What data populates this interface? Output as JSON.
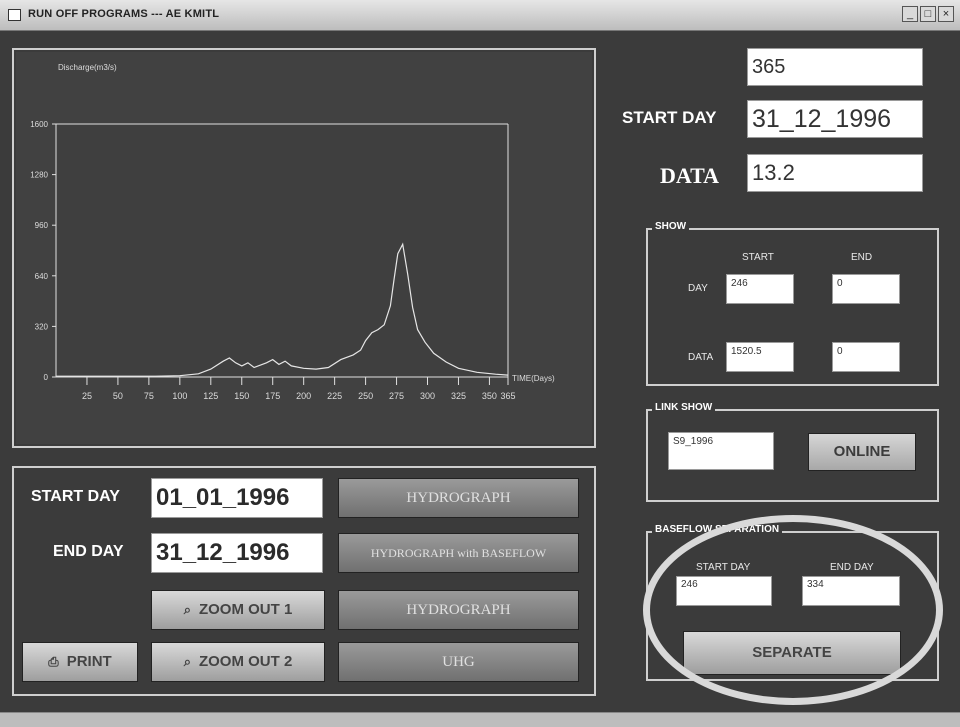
{
  "window": {
    "title": "RUN OFF PROGRAMS --- AE KMITL",
    "min_label": "_",
    "max_label": "□",
    "close_label": "×"
  },
  "top": {
    "days_value": "365",
    "start_day_label": "START DAY",
    "start_day_value": "31_12_1996",
    "data_label": "DATA",
    "data_value": "13.2"
  },
  "show": {
    "caption": "SHOW",
    "start_header": "START",
    "end_header": "END",
    "day_label": "DAY",
    "data_label": "DATA",
    "day_start": "246",
    "day_end": "0",
    "data_start": "1520.5",
    "data_end": "0"
  },
  "link_show": {
    "caption": "LINK SHOW",
    "value": "S9_1996",
    "online_label": "ONLINE"
  },
  "baseflow": {
    "caption": "BASEFLOW SEPARATION",
    "start_day_label": "START DAY",
    "end_day_label": "END DAY",
    "start_day_value": "246",
    "end_day_value": "334",
    "separate_label": "SEPARATE"
  },
  "controls": {
    "start_day_label": "START DAY",
    "start_day_value": "01_01_1996",
    "end_day_label": "END DAY",
    "end_day_value": "31_12_1996",
    "zoom_out_1": "ZOOM OUT 1",
    "zoom_out_2": "ZOOM OUT 2",
    "print_label": "PRINT",
    "hydrograph_btn": "HYDROGRAPH",
    "hydrograph_baseflow_btn": "HYDROGRAPH with BASEFLOW",
    "hydrograph_btn_2": "HYDROGRAPH",
    "uhg_btn": "UHG"
  },
  "chart_data": {
    "type": "line",
    "ylabel": "Discharge(m3/s)",
    "xlabel": "TIME(Days)",
    "xlim": [
      0,
      365
    ],
    "ylim": [
      0,
      1600
    ],
    "xticks": [
      25,
      50,
      75,
      100,
      125,
      150,
      175,
      200,
      225,
      250,
      275,
      300,
      325,
      350,
      365
    ],
    "yticks": [
      0,
      320,
      640,
      960,
      1280,
      1600
    ],
    "ytick_labels": [
      "0",
      "320",
      "640",
      "960",
      "1280",
      "1600"
    ],
    "colors": {
      "line": "#e6e6e6",
      "plot_bg": "#3f3f3f",
      "axis": "#e0e0e0"
    },
    "series": [
      {
        "x": [
          0,
          20,
          40,
          60,
          80,
          100,
          115,
          125,
          135,
          140,
          145,
          150,
          155,
          160,
          170,
          175,
          180,
          185,
          190,
          200,
          210,
          220,
          230,
          240,
          246,
          250,
          255,
          260,
          265,
          270,
          273,
          276,
          280,
          284,
          288,
          292,
          298,
          305,
          315,
          325,
          340,
          355,
          365
        ],
        "y": [
          5,
          5,
          5,
          5,
          5,
          8,
          20,
          50,
          100,
          120,
          90,
          70,
          90,
          60,
          90,
          110,
          80,
          100,
          70,
          55,
          50,
          60,
          110,
          140,
          170,
          230,
          280,
          300,
          330,
          450,
          620,
          780,
          840,
          650,
          440,
          300,
          220,
          150,
          95,
          55,
          30,
          18,
          12
        ]
      }
    ]
  }
}
